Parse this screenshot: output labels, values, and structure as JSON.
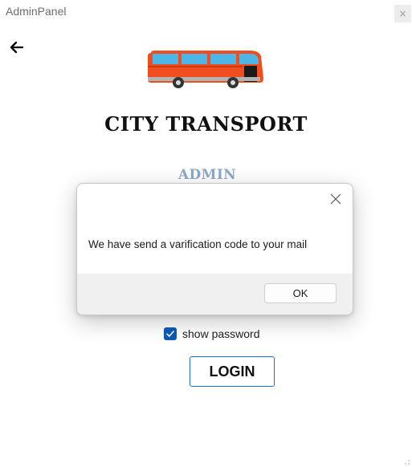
{
  "window": {
    "title": "AdminPanel",
    "close_glyph": "×"
  },
  "icons": {
    "back": "arrow-left-icon",
    "bus": "bus-icon",
    "close": "close-icon",
    "check": "checkmark-icon"
  },
  "app": {
    "title": "CITY TRANSPORT",
    "subtitle": "ADMIN LOGIN"
  },
  "form": {
    "show_password_label": "show password",
    "show_password_checked": true,
    "login_label": "LOGIN"
  },
  "dialog": {
    "message": "We have send a varification code to your mail",
    "ok_label": "OK"
  },
  "colors": {
    "accent": "#0B5CB8",
    "button_border": "#1E6FD0",
    "bus_body": "#F04E1E",
    "bus_windows": "#4DB6E6",
    "subtitle": "#8EA8C8"
  }
}
